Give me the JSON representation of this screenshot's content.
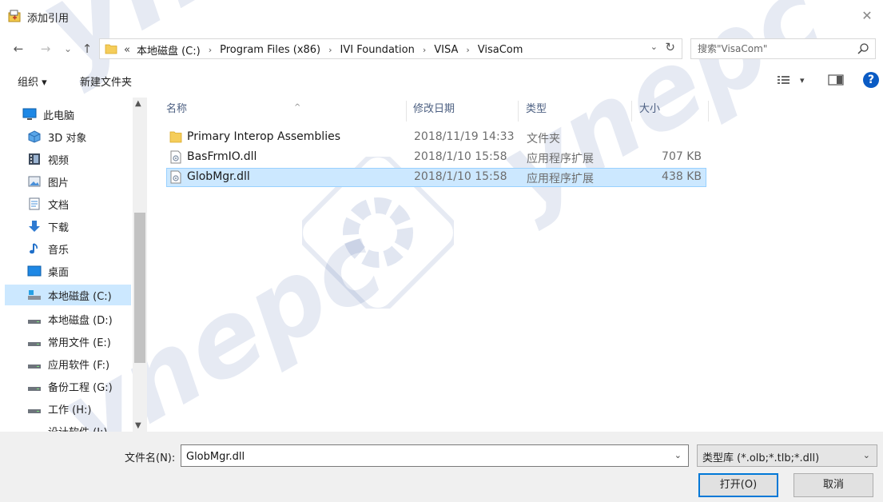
{
  "window": {
    "title": "添加引用",
    "close_glyph": "✕"
  },
  "nav_buttons": {
    "back": "←",
    "forward": "→",
    "recent": "⌄",
    "up": "↑"
  },
  "address": {
    "prefix": "«",
    "crumbs": [
      "本地磁盘 (C:)",
      "Program Files (x86)",
      "IVI Foundation",
      "VISA",
      "VisaCom"
    ],
    "separator": "›"
  },
  "search": {
    "placeholder": "搜索\"VisaCom\""
  },
  "toolbar": {
    "organize": "组织 ▾",
    "new_folder": "新建文件夹",
    "view_arrow": "▾",
    "help": "?"
  },
  "sidebar": {
    "items": [
      {
        "label": "此电脑",
        "icon": "computer-icon"
      },
      {
        "label": "3D 对象",
        "icon": "cube-icon"
      },
      {
        "label": "视频",
        "icon": "video-icon"
      },
      {
        "label": "图片",
        "icon": "picture-icon"
      },
      {
        "label": "文档",
        "icon": "document-icon"
      },
      {
        "label": "下载",
        "icon": "download-icon"
      },
      {
        "label": "音乐",
        "icon": "music-icon"
      },
      {
        "label": "桌面",
        "icon": "desktop-icon"
      },
      {
        "label": "本地磁盘 (C:)",
        "icon": "drive-c-icon",
        "selected": true
      },
      {
        "label": "本地磁盘 (D:)",
        "icon": "drive-icon"
      },
      {
        "label": "常用文件 (E:)",
        "icon": "drive-icon"
      },
      {
        "label": "应用软件 (F:)",
        "icon": "drive-icon"
      },
      {
        "label": "备份工程 (G:)",
        "icon": "drive-icon"
      },
      {
        "label": "工作 (H:)",
        "icon": "drive-icon"
      },
      {
        "label": "设计软件 (I:)",
        "icon": "drive-icon"
      }
    ]
  },
  "columns": {
    "name": "名称",
    "modified": "修改日期",
    "type": "类型",
    "size": "大小",
    "sort_glyph": "^"
  },
  "files": [
    {
      "name": "Primary Interop Assemblies",
      "modified": "2018/11/19 14:33",
      "type": "文件夹",
      "size": "",
      "icon": "folder-icon"
    },
    {
      "name": "BasFrmIO.dll",
      "modified": "2018/1/10 15:58",
      "type": "应用程序扩展",
      "size": "707 KB",
      "icon": "dll-file-icon"
    },
    {
      "name": "GlobMgr.dll",
      "modified": "2018/1/10 15:58",
      "type": "应用程序扩展",
      "size": "438 KB",
      "icon": "dll-file-icon",
      "selected": true
    }
  ],
  "footer": {
    "filename_label": "文件名(N):",
    "filename_value": "GlobMgr.dll",
    "filetype": "类型库 (*.olb;*.tlb;*.dll)",
    "open_button": "打开(O)",
    "cancel_button": "取消"
  },
  "watermark": {
    "text": "ynepc"
  },
  "colors": {
    "selection": "#cce8ff",
    "selection_border": "#99d1ff",
    "accent": "#0078d7",
    "help": "#0a5bc4"
  }
}
